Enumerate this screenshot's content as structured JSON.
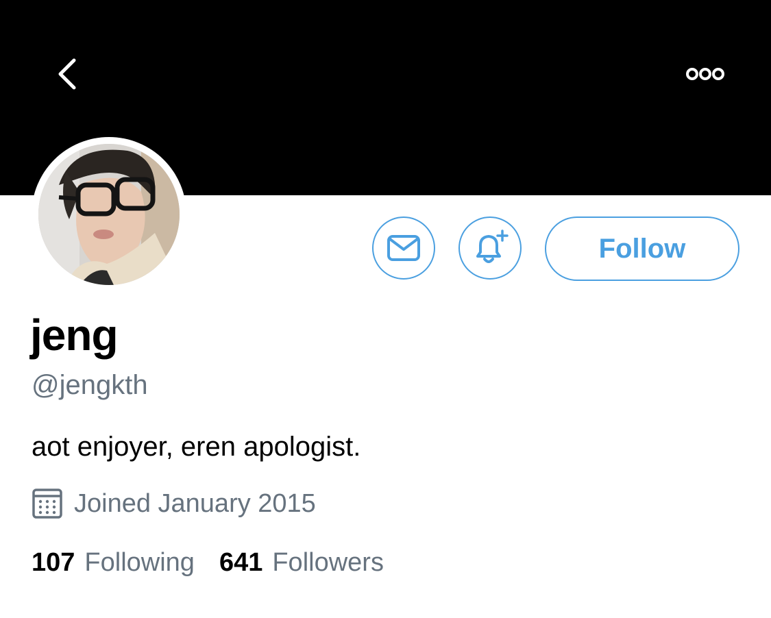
{
  "header": {
    "back_icon": "chevron-left-icon",
    "more_icon": "more-options-icon",
    "banner_color": "#000000"
  },
  "profile": {
    "avatar_icon": "profile-photo",
    "display_name": "jeng",
    "handle": "@jengkth",
    "bio": "aot enjoyer, eren apologist.",
    "joined": "Joined January 2015",
    "joined_icon": "calendar-icon"
  },
  "actions": {
    "message_icon": "envelope-icon",
    "notify_icon": "bell-plus-icon",
    "follow_label": "Follow",
    "accent_color": "#4a9fe0"
  },
  "stats": {
    "following_count": "107",
    "following_label": "Following",
    "followers_count": "641",
    "followers_label": "Followers"
  },
  "colors": {
    "secondary_text": "#66727e",
    "primary_text": "#000000"
  }
}
